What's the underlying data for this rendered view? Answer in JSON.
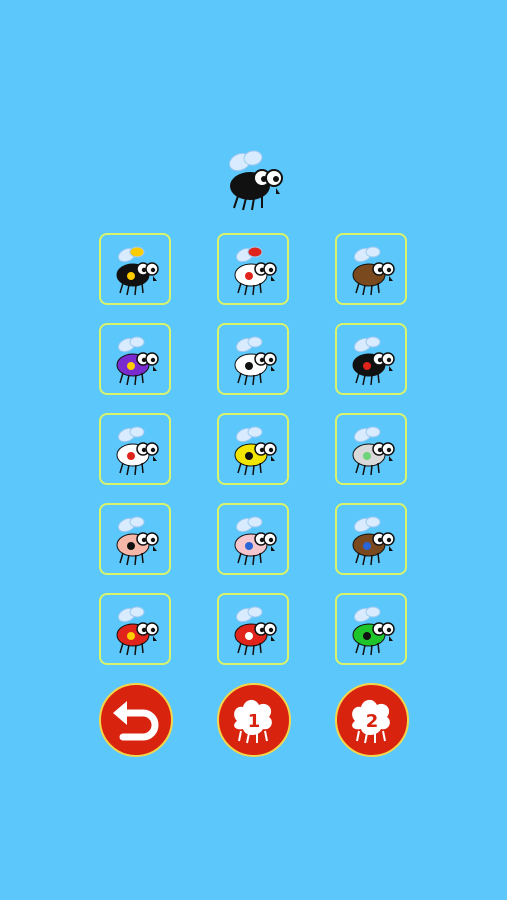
{
  "hero_fly": {
    "body_color": "#111111",
    "icon": "fly-icon"
  },
  "fly_skins": [
    {
      "name": "crown",
      "body_color": "#111111",
      "accent": "#ffcc00"
    },
    {
      "name": "red-bow",
      "body_color": "#ffffff",
      "accent": "#e0241b"
    },
    {
      "name": "brown",
      "body_color": "#7a4a1e",
      "accent": "#7a4a1e"
    },
    {
      "name": "purple",
      "body_color": "#7a2bd0",
      "accent": "#ffcc00"
    },
    {
      "name": "white",
      "body_color": "#ffffff",
      "accent": "#111111"
    },
    {
      "name": "black-red",
      "body_color": "#111111",
      "accent": "#e0241b"
    },
    {
      "name": "medic",
      "body_color": "#ffffff",
      "accent": "#e0241b"
    },
    {
      "name": "toxic",
      "body_color": "#f2e600",
      "accent": "#111111"
    },
    {
      "name": "grey-ring",
      "body_color": "#d9d9d9",
      "accent": "#6ed37a"
    },
    {
      "name": "hat-fly",
      "body_color": "#f6b6a8",
      "accent": "#111111"
    },
    {
      "name": "pink-cap",
      "body_color": "#f6c6cf",
      "accent": "#2a64d6"
    },
    {
      "name": "choco-cap",
      "body_color": "#7a4a1e",
      "accent": "#2a64d6"
    },
    {
      "name": "hero-bolt",
      "body_color": "#e0241b",
      "accent": "#ffcc00"
    },
    {
      "name": "red-eyes",
      "body_color": "#e0241b",
      "accent": "#ffffff"
    },
    {
      "name": "green-angry",
      "body_color": "#1fc42a",
      "accent": "#111111"
    }
  ],
  "controls": [
    {
      "name": "back",
      "icon": "undo-arrow-icon"
    },
    {
      "name": "player-1",
      "label": "1",
      "icon": "fly-silhouette-icon"
    },
    {
      "name": "player-2",
      "label": "2",
      "icon": "fly-silhouette-icon"
    }
  ],
  "colors": {
    "background": "#5cc7fb",
    "tile_border": "#d9f36a",
    "button": "#d8230f",
    "button_border": "#f4d64a"
  }
}
